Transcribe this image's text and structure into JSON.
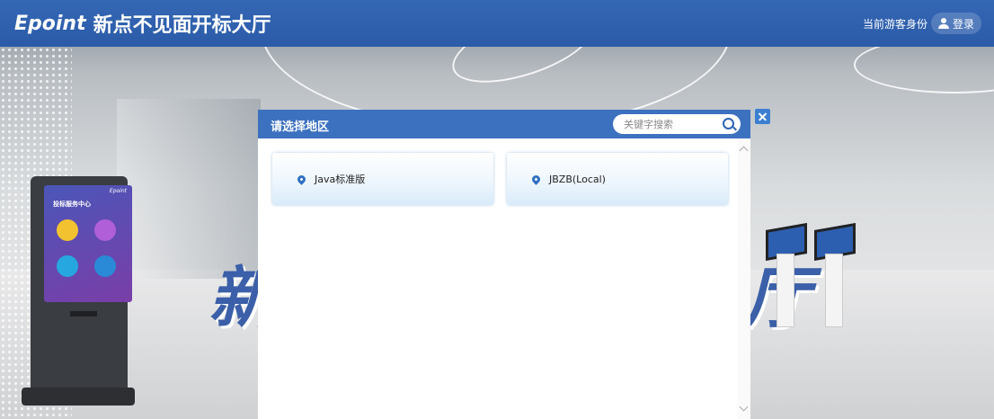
{
  "header": {
    "brand_logo": "Epoint",
    "brand_title": "新点不见面开标大厅",
    "guest_label": "当前游客身份",
    "login_label": "登录"
  },
  "background": {
    "left_glyph": "新",
    "right_glyph": "厅",
    "kiosk_brand": "Epoint",
    "kiosk_title": "投标服务中心"
  },
  "modal": {
    "title": "请选择地区",
    "search": {
      "placeholder": "关键字搜索",
      "value": ""
    },
    "regions": [
      {
        "label": "Java标准版"
      },
      {
        "label": "JBZB(Local)"
      }
    ]
  },
  "colors": {
    "header_bg": "#2b5ba8",
    "modal_header_bg": "#3c71c0",
    "accent": "#2f6fc4"
  }
}
